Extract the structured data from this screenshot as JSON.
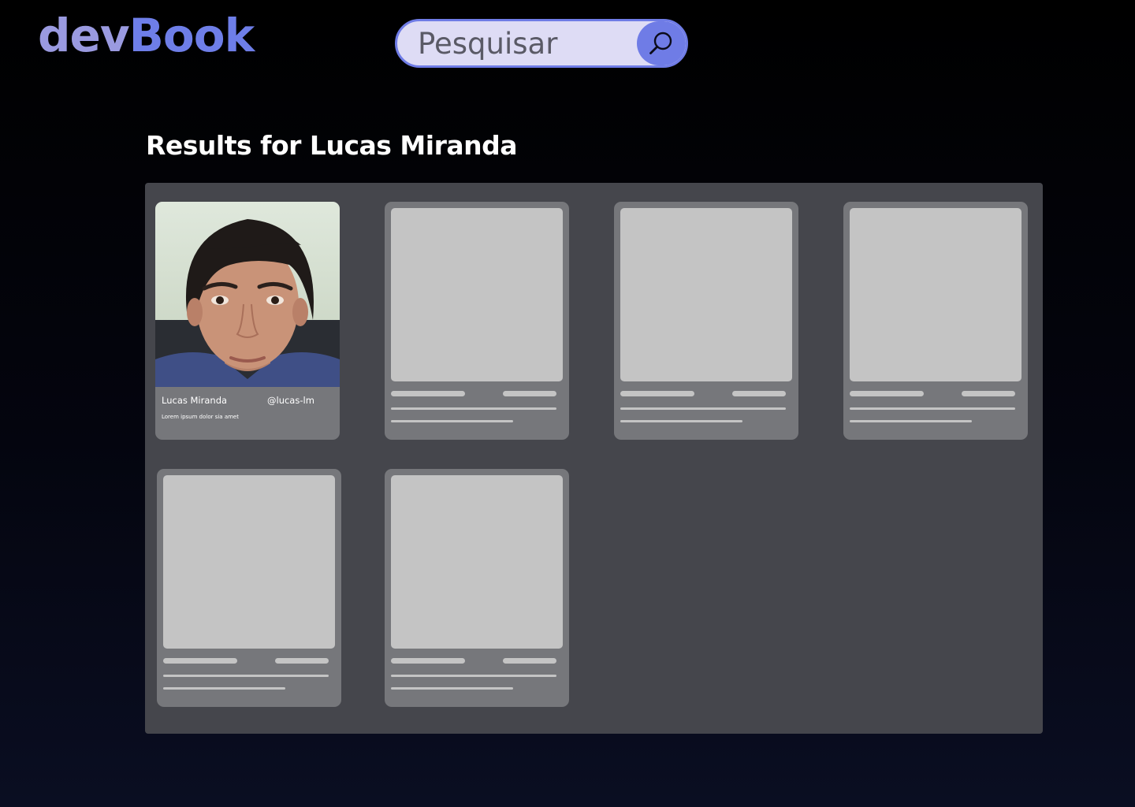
{
  "header": {
    "logo_part1": "dev",
    "logo_part2": "Book",
    "search": {
      "placeholder": "Pesquisar",
      "value": ""
    },
    "accent_color": "#6f7ce6"
  },
  "results": {
    "title": "Results for Lucas Miranda",
    "cards": [
      {
        "name": "Lucas Miranda",
        "handle": "@lucas-lm",
        "bio": "Lorem ipsum dolor sia amet",
        "loaded": true
      },
      {
        "loaded": false
      },
      {
        "loaded": false
      },
      {
        "loaded": false
      },
      {
        "loaded": false
      },
      {
        "loaded": false
      }
    ]
  }
}
